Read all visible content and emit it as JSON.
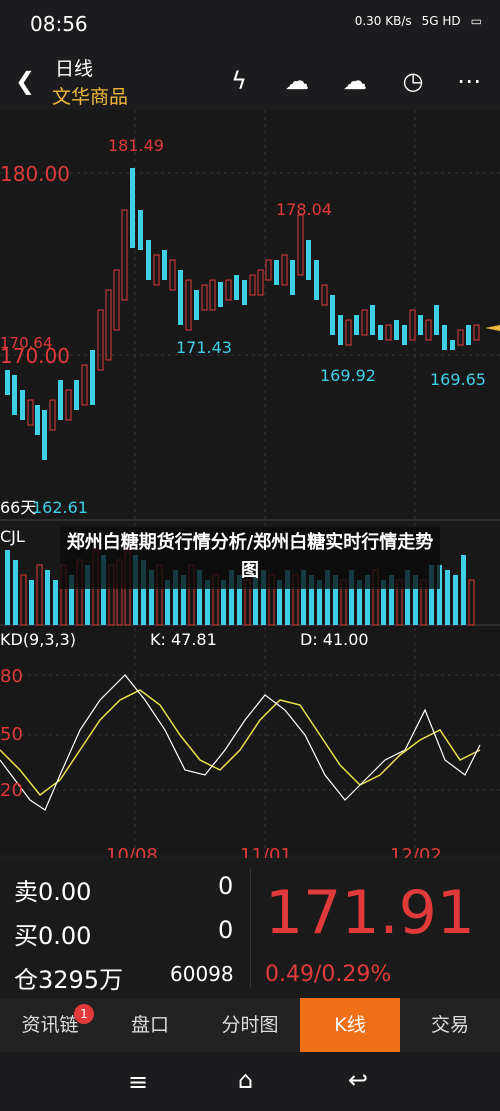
{
  "status": {
    "time": "08:56",
    "speed": "0.30 KB/s",
    "network": "5G HD"
  },
  "header": {
    "period": "日线",
    "name": "文华商品"
  },
  "chart": {
    "price_high_label": "181.49",
    "peak2_label": "178.04",
    "axis_180": "180.00",
    "axis_170": "170.00",
    "axis_170_64": "170.64",
    "low1_label": "171.43",
    "low2_label": "169.92",
    "low3_label": "169.65",
    "low_left_label": "162.61",
    "days_label": "66天",
    "cjl_label": "CJL",
    "kd_label": "KD(9,3,3)",
    "kd_k": "K: 47.81",
    "kd_d": "D: 41.00",
    "kd_80": "80",
    "kd_50": "50",
    "kd_20": "20",
    "dates": [
      "10/08",
      "11/01",
      "12/02"
    ],
    "overlay_title": "郑州白糖期货行情分析/郑州白糖实时行情走势图"
  },
  "quote": {
    "sell_label": "卖",
    "sell_price": "0.00",
    "sell_vol": "0",
    "buy_label": "买",
    "buy_price": "0.00",
    "buy_vol": "0",
    "pos_label": "仓",
    "pos_value": "3295万",
    "pos_vol": "60098",
    "last": "171.91",
    "change": "0.49/0.29%"
  },
  "tabs": [
    "资讯链",
    "盘口",
    "分时图",
    "K线",
    "交易"
  ],
  "tab_badge": "1"
}
